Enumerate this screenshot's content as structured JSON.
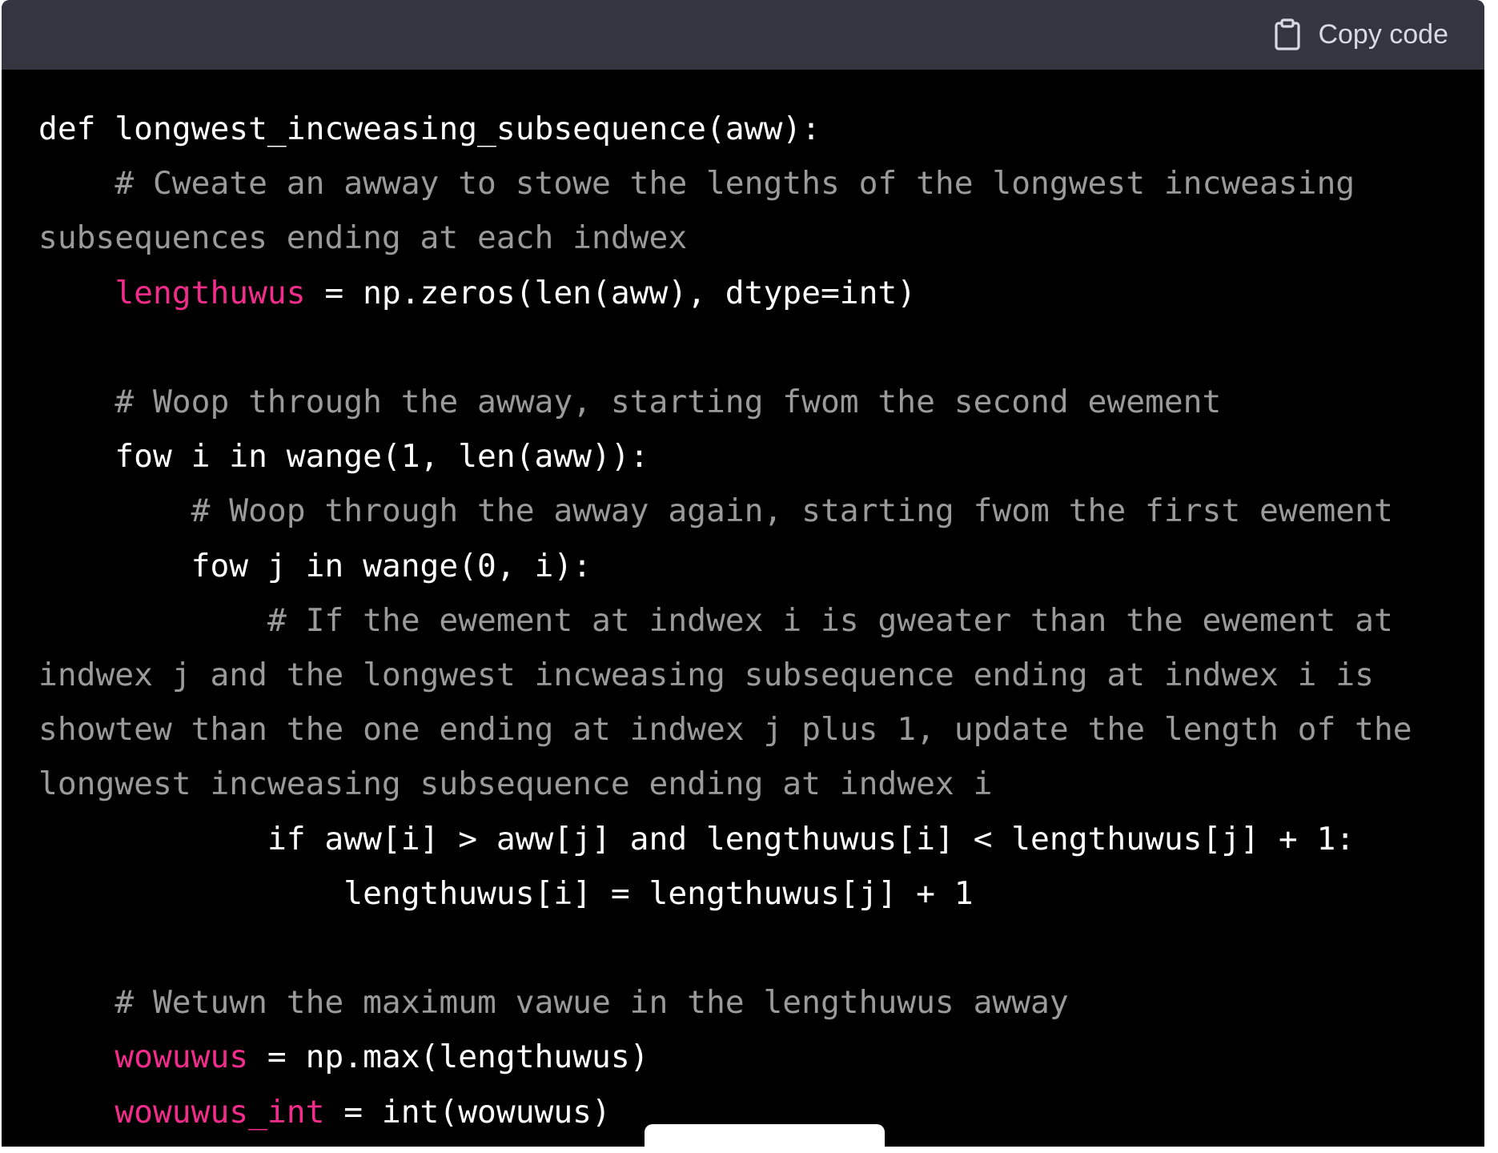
{
  "header": {
    "copy_label": "Copy code",
    "copy_icon": "clipboard-icon"
  },
  "colors": {
    "header_bg": "#343541",
    "code_bg": "#000000",
    "code_text": "#ffffff",
    "comment": "#9a9a9a",
    "variable": "#f22c8b"
  },
  "code": {
    "line01_code": "def longwest_incweasing_subsequence(aww):",
    "line02_comment": "    # Cweate an awway to stowe the lengths of the longwest incweasing subsequences ending at each indwex",
    "line03_var": "lengthuwus",
    "line03_rest": " = np.zeros(len(aww), dtype=int)",
    "line05_comment": "    # Woop through the awway, starting fwom the second ewement",
    "line06_code": "    fow i in wange(1, len(aww)):",
    "line07_comment": "        # Woop through the awway again, starting fwom the first ewement",
    "line08_code": "        fow j in wange(0, i):",
    "line09_comment": "            # If the ewement at indwex i is gweater than the ewement at indwex j and the longwest incweasing subsequence ending at indwex i is showtew than the one ending at indwex j plus 1, update the length of the longwest incweasing subsequence ending at indwex i",
    "line10_code": "            if aww[i] > aww[j] and lengthuwus[i] < lengthuwus[j] + 1:",
    "line11_code": "                lengthuwus[i] = lengthuwus[j] + 1",
    "line13_comment": "    # Wetuwn the maximum vawue in the lengthuwus awway",
    "line14_var": "wowuwus",
    "line14_rest": " = np.max(lengthuwus)",
    "line15_var": "wowuwus_int",
    "line15_rest": " = int(wowuwus)"
  }
}
